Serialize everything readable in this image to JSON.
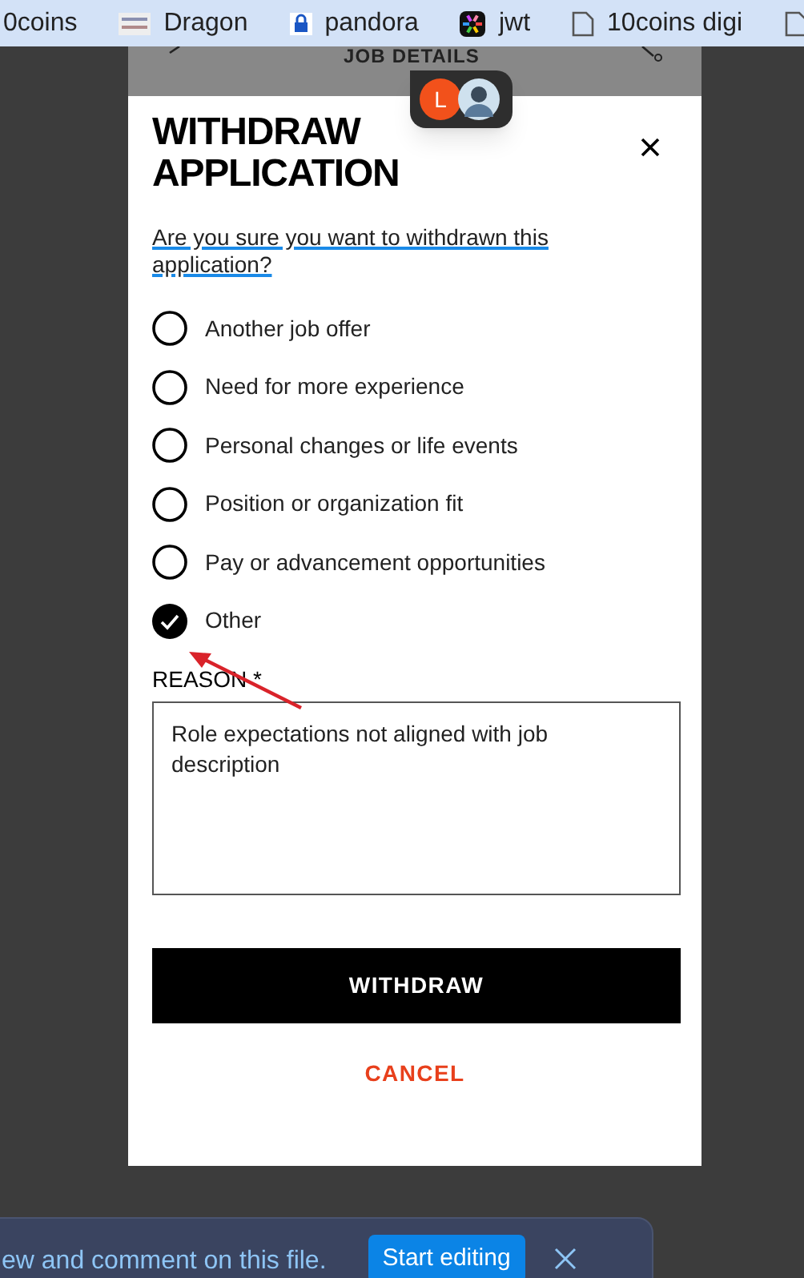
{
  "bookmarks": [
    {
      "label": "0coins",
      "kind": "none"
    },
    {
      "label": "Dragon",
      "kind": "image"
    },
    {
      "label": "pandora",
      "kind": "lock"
    },
    {
      "label": "jwt",
      "kind": "app"
    },
    {
      "label": "10coins digi",
      "kind": "page"
    },
    {
      "kind": "page"
    }
  ],
  "header": {
    "title": "JOB DETAILS"
  },
  "presence": {
    "initial": "L"
  },
  "dialog": {
    "title": "WITHDRAW APPLICATION",
    "question": "Are you sure you want to withdrawn this application?",
    "options": [
      {
        "label": "Another job offer",
        "selected": false
      },
      {
        "label": "Need for more experience",
        "selected": false
      },
      {
        "label": "Personal changes or life events",
        "selected": false
      },
      {
        "label": "Position or organization fit",
        "selected": false
      },
      {
        "label": "Pay or advancement opportunities",
        "selected": false
      },
      {
        "label": "Other",
        "selected": true
      }
    ],
    "reason_label": "REASON *",
    "reason_value": "Role expectations not aligned with job description",
    "primary_button": "WITHDRAW",
    "cancel_button": "CANCEL"
  },
  "banner": {
    "text": "ew and comment on this file.",
    "button": "Start editing"
  }
}
